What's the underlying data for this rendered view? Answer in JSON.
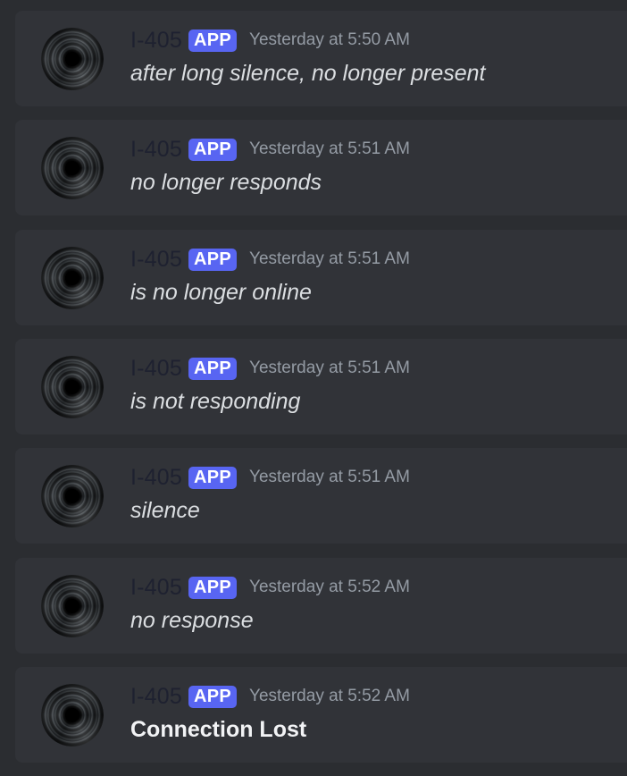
{
  "messages": [
    {
      "author": "I-405",
      "badge": "APP",
      "timestamp": "Yesterday at 5:50 AM",
      "text": "after long silence, no longer present",
      "style": "italic"
    },
    {
      "author": "I-405",
      "badge": "APP",
      "timestamp": "Yesterday at 5:51 AM",
      "text": "no longer responds",
      "style": "italic"
    },
    {
      "author": "I-405",
      "badge": "APP",
      "timestamp": "Yesterday at 5:51 AM",
      "text": "is no longer online",
      "style": "italic"
    },
    {
      "author": "I-405",
      "badge": "APP",
      "timestamp": "Yesterday at 5:51 AM",
      "text": "is not responding",
      "style": "italic"
    },
    {
      "author": "I-405",
      "badge": "APP",
      "timestamp": "Yesterday at 5:51 AM",
      "text": "silence",
      "style": "italic"
    },
    {
      "author": "I-405",
      "badge": "APP",
      "timestamp": "Yesterday at 5:52 AM",
      "text": "no response",
      "style": "italic"
    },
    {
      "author": "I-405",
      "badge": "APP",
      "timestamp": "Yesterday at 5:52 AM",
      "text": "Connection Lost",
      "style": "bold"
    }
  ],
  "colors": {
    "background": "#2b2d31",
    "message_background": "#313338",
    "author": "#1e2130",
    "badge": "#5865f2",
    "timestamp": "#949ba4",
    "text": "#dbdee1"
  },
  "icons": {
    "avatar": "black-hole-avatar-icon"
  }
}
